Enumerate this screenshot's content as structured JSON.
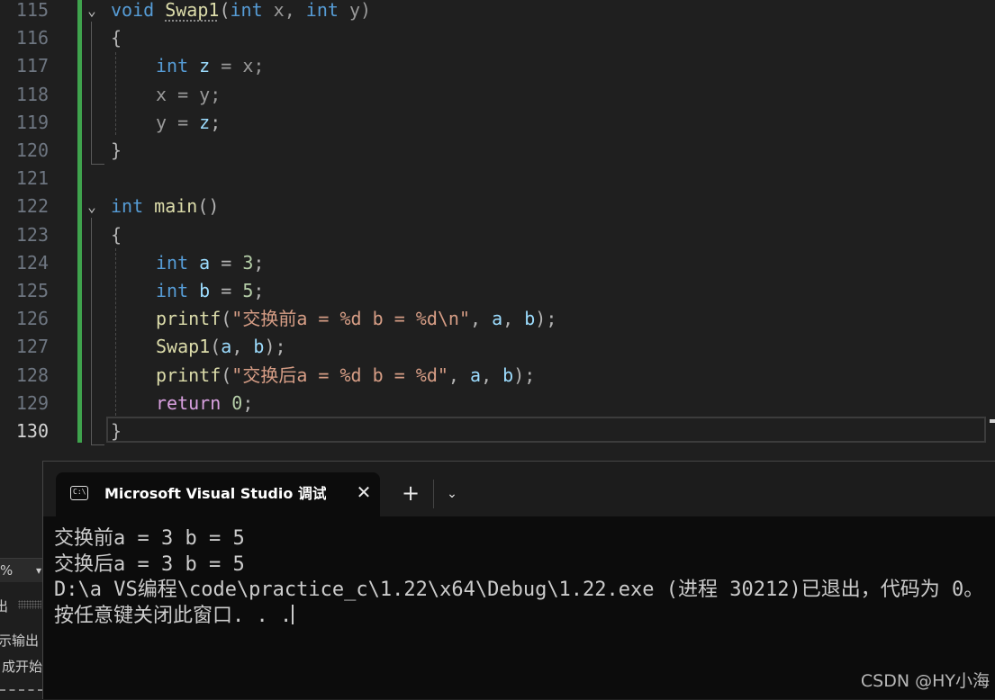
{
  "editor": {
    "line_numbers": [
      "115",
      "116",
      "117",
      "118",
      "119",
      "120",
      "121",
      "122",
      "123",
      "124",
      "125",
      "126",
      "127",
      "128",
      "129",
      "130"
    ],
    "active_line": "130",
    "code": {
      "l115": {
        "kw_void": "void",
        "fn": "Swap1",
        "p1": "(",
        "kw_int1": "int",
        "x": " x, ",
        "kw_int2": "int",
        "y": " y)"
      },
      "l116": "{",
      "l117": {
        "kw": "int",
        "var": "z",
        "rest": " = x;"
      },
      "l118": "x = y;",
      "l119": {
        "pre": "y = ",
        "var": "z",
        "post": ";"
      },
      "l120": "}",
      "l122": {
        "kw": "int",
        "fn": "main",
        "rest": "()"
      },
      "l123": "{",
      "l124": {
        "kw": "int",
        "var": "a",
        "eq": " = ",
        "num": "3",
        "end": ";"
      },
      "l125": {
        "kw": "int",
        "var": "b",
        "eq": " = ",
        "num": "5",
        "end": ";"
      },
      "l126": {
        "fn": "printf",
        "open": "(",
        "str": "\"交换前a = %d b = %d\\n\"",
        "sep1": ", ",
        "a": "a",
        "sep2": ", ",
        "b": "b",
        "close": ");"
      },
      "l127": {
        "fn": "Swap1",
        "open": "(",
        "a": "a",
        "sep": ", ",
        "b": "b",
        "close": ");"
      },
      "l128": {
        "fn": "printf",
        "open": "(",
        "str": "\"交换后a = %d b = %d\"",
        "sep1": ", ",
        "a": "a",
        "sep2": ", ",
        "b": "b",
        "close": ");"
      },
      "l129": {
        "kw": "return",
        "num": "0",
        "end": ";"
      },
      "l130": "}"
    }
  },
  "side_panel": {
    "zoom": "%",
    "output_label": "出",
    "line1": "示输出",
    "line2": "成开始"
  },
  "console": {
    "tab_title": "Microsoft Visual Studio 调试控制台",
    "icon_text": "C:\\",
    "close_glyph": "✕",
    "new_tab_glyph": "+",
    "menu_glyph": "⌄",
    "lines": [
      "交换前a = 3 b = 5",
      "交换后a = 3 b = 5",
      "D:\\a VS编程\\code\\practice_c\\1.22\\x64\\Debug\\1.22.exe (进程 30212)已退出，代码为 0。",
      "按任意键关闭此窗口. . ."
    ]
  },
  "watermark": "CSDN @HY小海",
  "colors": {
    "editor_bg": "#1f1f1f",
    "keyword": "#569cd6",
    "function": "#dcdcaa",
    "variable": "#9cdcfe",
    "number": "#b5cea8",
    "string": "#d69d85",
    "control": "#d8a0df",
    "change_bar": "#3fa34d",
    "console_bg": "#0c0c0c"
  }
}
